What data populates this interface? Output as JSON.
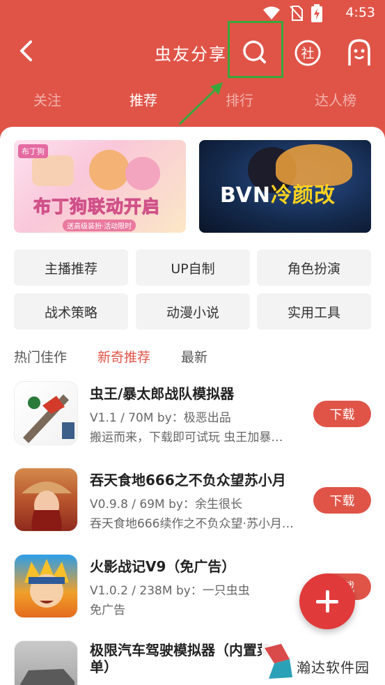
{
  "status": {
    "time": "4:53"
  },
  "header": {
    "title": "虫友分享",
    "search_label": "",
    "she_label": "社"
  },
  "tabs": [
    {
      "label": "关注",
      "active": false
    },
    {
      "label": "推荐",
      "active": true
    },
    {
      "label": "排行",
      "active": false
    },
    {
      "label": "达人榜",
      "active": false
    }
  ],
  "banners": [
    {
      "logo": "布丁狗",
      "text": "布丁狗联动开启",
      "sub": "送高级装扮·活动限时"
    },
    {
      "text_a": "BVN",
      "text_b": "冷颜改"
    }
  ],
  "categories": [
    "主播推荐",
    "UP自制",
    "角色扮演",
    "战术策略",
    "动漫小说",
    "实用工具"
  ],
  "subtabs": [
    {
      "label": "热门佳作",
      "active": false
    },
    {
      "label": "新奇推荐",
      "active": true
    },
    {
      "label": "最新",
      "active": false
    }
  ],
  "items": [
    {
      "title": "虫王/暴太郎战队模拟器",
      "meta": "V1.1 / 70M  by：极恶出品",
      "desc": "搬运而来，下载即可试玩 虫王加暴…",
      "button": "下载"
    },
    {
      "title": "吞天食地666之不负众望苏小月",
      "meta": "V0.9.8 / 69M  by：余生很长",
      "desc": "吞天食地666续作之不负众望·苏小月…",
      "button": "下载"
    },
    {
      "title": "火影战记V9（免广告）",
      "meta": "V1.0.2 / 238M  by：一只虫虫",
      "desc": "免广告",
      "button": "下载"
    },
    {
      "title": "极限汽车驾驶模拟器（内置菜单）",
      "meta": "",
      "desc": "",
      "button": ""
    }
  ],
  "watermark": {
    "text": "瀚达软件园"
  },
  "colors": {
    "primary": "#e05448",
    "highlight": "#3aa63a",
    "fab": "#e03a3a"
  }
}
